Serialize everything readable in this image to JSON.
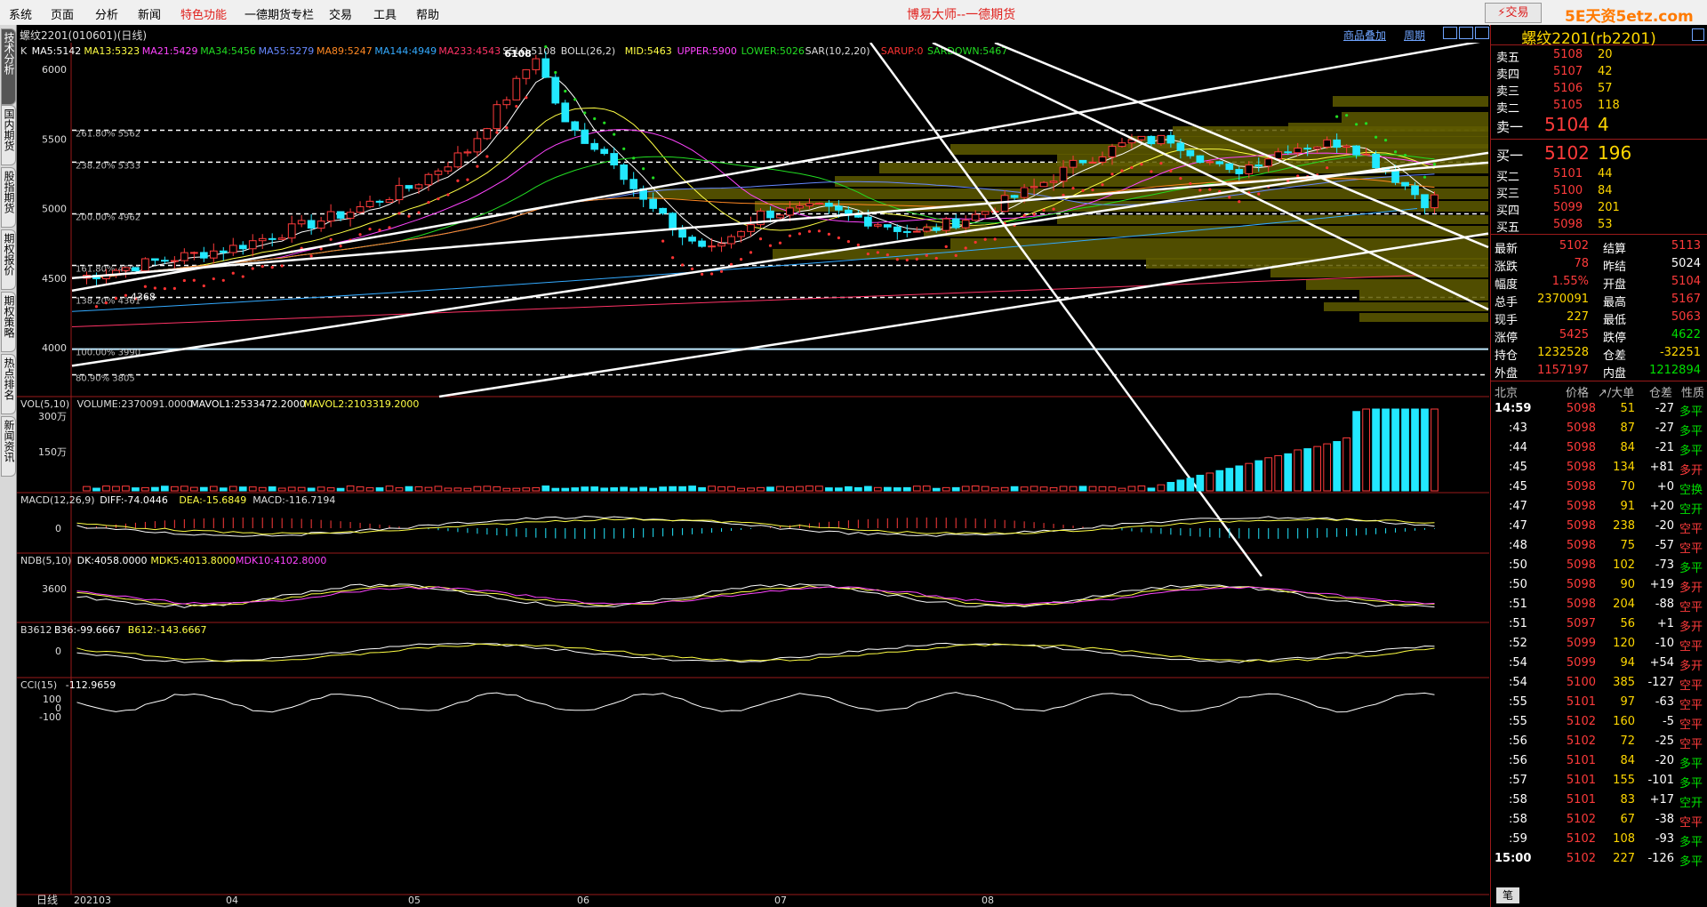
{
  "menu": {
    "items": [
      "系统",
      "页面",
      "分析",
      "新闻",
      "特色功能",
      "一德期货专栏",
      "交易",
      "工具",
      "帮助"
    ],
    "highlight": "特色功能",
    "app_title": "博易大师--一德期货",
    "trade_button": "⚡交易",
    "watermark": "5E天资5etz.com"
  },
  "sidetabs": [
    "技术分析",
    "国内期货",
    "股指期货",
    "期权报价",
    "期权策略",
    "热点排名",
    "新闻资讯"
  ],
  "chart": {
    "symbol": "螺纹2201(010601)(日线)",
    "link_overlay": "商品叠加",
    "link_period": "周期",
    "main_indicators": [
      {
        "text": "K",
        "color": "#dddddd"
      },
      {
        "text": "MA5:5142",
        "color": "#ffffff"
      },
      {
        "text": "MA13:5323",
        "color": "#ffff44"
      },
      {
        "text": "MA21:5429",
        "color": "#ff44ff"
      },
      {
        "text": "MA34:5456",
        "color": "#22dd22"
      },
      {
        "text": "MA55:5279",
        "color": "#6688ff"
      },
      {
        "text": "MA89:5247",
        "color": "#ff8822"
      },
      {
        "text": "MA144:4949",
        "color": "#33aaff"
      },
      {
        "text": "MA233:4543",
        "color": "#ff3366"
      },
      {
        "text": "SSLO 5108",
        "color": "#dddddd"
      },
      {
        "text": "BOLL(26,2)",
        "color": "#dddddd"
      },
      {
        "text": "MID:5463",
        "color": "#ffff44"
      },
      {
        "text": "UPPER:5900",
        "color": "#ff44ff"
      },
      {
        "text": "LOWER:5026",
        "color": "#22dd22"
      },
      {
        "text": "SAR(10,2,20)",
        "color": "#dddddd"
      },
      {
        "text": "SARUP:0",
        "color": "#ff3333"
      },
      {
        "text": "SARDOWN:5467",
        "color": "#22dd22"
      }
    ],
    "price_axis": [
      "6000",
      "5500",
      "5000",
      "4500",
      "4000"
    ],
    "peak_label": "6108",
    "low_label": "4368",
    "fib_levels": [
      {
        "label": "261.80% 5562",
        "price": 5562
      },
      {
        "label": "238.20% 5333",
        "price": 5333
      },
      {
        "label": "200.00% 4962",
        "price": 4962
      },
      {
        "label": "161.80% 4591",
        "price": 4591
      },
      {
        "label": "138.20% 4361",
        "price": 4361
      },
      {
        "label": "100.00% 3990",
        "price": 3990
      },
      {
        "label": "80.90% 3805",
        "price": 3805
      }
    ],
    "volume": {
      "title": "VOL(5,10)",
      "parts": [
        {
          "text": "VOL(5,10)",
          "color": "#dddddd"
        },
        {
          "text": "VOLUME:2370091.0000",
          "color": "#dddddd"
        },
        {
          "text": "MAVOL1:2533472.2000",
          "color": "#ffffff"
        },
        {
          "text": "MAVOL2:2103319.2000",
          "color": "#ffff44"
        }
      ],
      "axis": [
        "300万",
        "150万"
      ]
    },
    "macd": {
      "parts": [
        {
          "text": "MACD(12,26,9)",
          "color": "#dddddd"
        },
        {
          "text": "DIFF:-74.0446",
          "color": "#ffffff"
        },
        {
          "text": "DEA:-15.6849",
          "color": "#ffff44"
        },
        {
          "text": "MACD:-116.7194",
          "color": "#dddddd"
        }
      ],
      "axis": [
        "0"
      ]
    },
    "ndb": {
      "parts": [
        {
          "text": "NDB(5,10)",
          "color": "#dddddd"
        },
        {
          "text": "DK:4058.0000",
          "color": "#ffffff"
        },
        {
          "text": "MDK5:4013.8000",
          "color": "#ffff44"
        },
        {
          "text": "MDK10:4102.8000",
          "color": "#ff44ff"
        }
      ],
      "axis": [
        "3600"
      ]
    },
    "b3612": {
      "parts": [
        {
          "text": "B3612",
          "color": "#dddddd"
        },
        {
          "text": "B36:-99.6667",
          "color": "#ffffff"
        },
        {
          "text": "B612:-143.6667",
          "color": "#ffff44"
        }
      ],
      "axis": [
        "0"
      ]
    },
    "cci": {
      "parts": [
        {
          "text": "CCI(15)",
          "color": "#dddddd"
        },
        {
          "text": "-112.9659",
          "color": "#ffffff"
        }
      ],
      "axis": [
        "100",
        "0",
        "-100"
      ]
    },
    "time_axis": {
      "period": "日线",
      "labels": [
        "202103",
        "04",
        "05",
        "06",
        "07",
        "08"
      ]
    }
  },
  "quote": {
    "title": "螺纹2201(rb2201)",
    "asks": [
      {
        "label": "卖五",
        "price": "5108",
        "vol": "20"
      },
      {
        "label": "卖四",
        "price": "5107",
        "vol": "42"
      },
      {
        "label": "卖三",
        "price": "5106",
        "vol": "57"
      },
      {
        "label": "卖二",
        "price": "5105",
        "vol": "118"
      },
      {
        "label": "卖一",
        "price": "5104",
        "vol": "4"
      }
    ],
    "bids": [
      {
        "label": "买一",
        "price": "5102",
        "vol": "196"
      },
      {
        "label": "买二",
        "price": "5101",
        "vol": "44"
      },
      {
        "label": "买三",
        "price": "5100",
        "vol": "84"
      },
      {
        "label": "买四",
        "price": "5099",
        "vol": "201"
      },
      {
        "label": "买五",
        "price": "5098",
        "vol": "53"
      }
    ],
    "stats": [
      {
        "l1": "最新",
        "v1": "5102",
        "c1": "red",
        "l2": "结算",
        "v2": "5113",
        "c2": "red"
      },
      {
        "l1": "涨跌",
        "v1": "78",
        "c1": "red",
        "l2": "昨结",
        "v2": "5024",
        "c2": "white"
      },
      {
        "l1": "幅度",
        "v1": "1.55%",
        "c1": "red",
        "l2": "开盘",
        "v2": "5104",
        "c2": "red"
      },
      {
        "l1": "总手",
        "v1": "2370091",
        "c1": "yellow",
        "l2": "最高",
        "v2": "5167",
        "c2": "red"
      },
      {
        "l1": "现手",
        "v1": "227",
        "c1": "yellow",
        "l2": "最低",
        "v2": "5063",
        "c2": "red"
      },
      {
        "l1": "涨停",
        "v1": "5425",
        "c1": "red",
        "l2": "跌停",
        "v2": "4622",
        "c2": "green"
      },
      {
        "l1": "持仓",
        "v1": "1232528",
        "c1": "yellow",
        "l2": "仓差",
        "v2": "-32251",
        "c2": "yellow"
      },
      {
        "l1": "外盘",
        "v1": "1157197",
        "c1": "red",
        "l2": "内盘",
        "v2": "1212894",
        "c2": "green"
      }
    ],
    "tick_header": {
      "loc": "北京",
      "price": "价格",
      "big": "↗/大单",
      "oi": "仓差",
      "nature": "性质"
    },
    "ticks": [
      {
        "t": "14:59",
        "p": "5098",
        "pc": "red",
        "v": "51",
        "oi": "-27",
        "n": "多平",
        "nc": "green",
        "bold": true
      },
      {
        "t": ":43",
        "p": "5098",
        "pc": "red",
        "v": "87",
        "oi": "-27",
        "n": "多平",
        "nc": "green"
      },
      {
        "t": ":44",
        "p": "5098",
        "pc": "red",
        "v": "84",
        "oi": "-21",
        "n": "多平",
        "nc": "green"
      },
      {
        "t": ":45",
        "p": "5098",
        "pc": "red",
        "v": "134",
        "oi": "+81",
        "n": "多开",
        "nc": "red"
      },
      {
        "t": ":45",
        "p": "5098",
        "pc": "red",
        "v": "70",
        "oi": "+0",
        "n": "空换",
        "nc": "green"
      },
      {
        "t": ":47",
        "p": "5098",
        "pc": "red",
        "v": "91",
        "oi": "+20",
        "n": "空开",
        "nc": "green"
      },
      {
        "t": ":47",
        "p": "5098",
        "pc": "red",
        "v": "238",
        "oi": "-20",
        "n": "空平",
        "nc": "red"
      },
      {
        "t": ":48",
        "p": "5098",
        "pc": "red",
        "v": "75",
        "oi": "-57",
        "n": "空平",
        "nc": "red"
      },
      {
        "t": ":50",
        "p": "5098",
        "pc": "red",
        "v": "102",
        "oi": "-73",
        "n": "多平",
        "nc": "green"
      },
      {
        "t": ":50",
        "p": "5098",
        "pc": "red",
        "v": "90",
        "oi": "+19",
        "n": "多开",
        "nc": "red"
      },
      {
        "t": ":51",
        "p": "5098",
        "pc": "red",
        "v": "204",
        "oi": "-88",
        "n": "空平",
        "nc": "red"
      },
      {
        "t": ":51",
        "p": "5097",
        "pc": "red",
        "v": "56",
        "oi": "+1",
        "n": "多开",
        "nc": "red"
      },
      {
        "t": ":52",
        "p": "5099",
        "pc": "red",
        "v": "120",
        "oi": "-10",
        "n": "空平",
        "nc": "red"
      },
      {
        "t": ":54",
        "p": "5099",
        "pc": "red",
        "v": "94",
        "oi": "+54",
        "n": "多开",
        "nc": "red"
      },
      {
        "t": ":54",
        "p": "5100",
        "pc": "red",
        "v": "385",
        "oi": "-127",
        "n": "空平",
        "nc": "red"
      },
      {
        "t": ":55",
        "p": "5101",
        "pc": "red",
        "v": "97",
        "oi": "-63",
        "n": "空平",
        "nc": "red"
      },
      {
        "t": ":55",
        "p": "5102",
        "pc": "red",
        "v": "160",
        "oi": "-5",
        "n": "空平",
        "nc": "red"
      },
      {
        "t": ":56",
        "p": "5102",
        "pc": "red",
        "v": "72",
        "oi": "-25",
        "n": "空平",
        "nc": "red"
      },
      {
        "t": ":56",
        "p": "5101",
        "pc": "red",
        "v": "84",
        "oi": "-20",
        "n": "多平",
        "nc": "green"
      },
      {
        "t": ":57",
        "p": "5101",
        "pc": "red",
        "v": "155",
        "oi": "-101",
        "n": "多平",
        "nc": "green"
      },
      {
        "t": ":58",
        "p": "5101",
        "pc": "red",
        "v": "83",
        "oi": "+17",
        "n": "空开",
        "nc": "green"
      },
      {
        "t": ":58",
        "p": "5102",
        "pc": "red",
        "v": "67",
        "oi": "-38",
        "n": "空平",
        "nc": "red"
      },
      {
        "t": ":59",
        "p": "5102",
        "pc": "red",
        "v": "108",
        "oi": "-93",
        "n": "多平",
        "nc": "green"
      },
      {
        "t": "15:00",
        "p": "5102",
        "pc": "red",
        "v": "227",
        "oi": "-126",
        "n": "多平",
        "nc": "green",
        "bold": true
      }
    ],
    "bottom_tab": "笔"
  }
}
